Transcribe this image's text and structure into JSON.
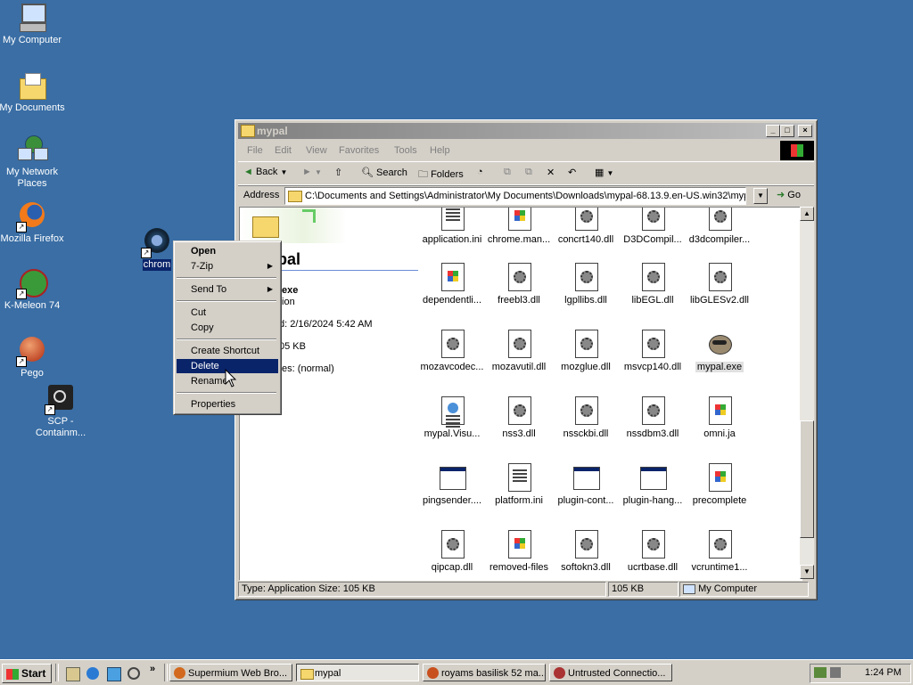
{
  "desktop": {
    "icons": [
      {
        "label": "My Computer"
      },
      {
        "label": "My Documents"
      },
      {
        "label": "My Network Places"
      },
      {
        "label": "Mozilla Firefox"
      },
      {
        "label": "K-Meleon 74"
      },
      {
        "label": "Pego"
      },
      {
        "label": "SCP - Containm..."
      },
      {
        "label": "chrom"
      }
    ]
  },
  "window": {
    "title": "mypal",
    "menu": [
      "File",
      "Edit",
      "View",
      "Favorites",
      "Tools",
      "Help"
    ],
    "toolbar": {
      "back": "Back",
      "search": "Search",
      "folders": "Folders"
    },
    "address_label": "Address",
    "address": "C:\\Documents and Settings\\Administrator\\My Documents\\Downloads\\mypal-68.13.9.en-US.win32\\mypal",
    "go": "Go",
    "webview": {
      "folder_title": "pal",
      "file_name": ".exe",
      "file_type": "tion",
      "modified": "d: 2/16/2024 5:42 AM",
      "size": "05 KB",
      "attributes": "tes: (normal)"
    },
    "files": [
      {
        "name": "application.ini",
        "icon": "ini-icon"
      },
      {
        "name": "chrome.man...",
        "icon": "windows-file-icon"
      },
      {
        "name": "concrt140.dll",
        "icon": "dll-icon"
      },
      {
        "name": "D3DCompil...",
        "icon": "dll-icon"
      },
      {
        "name": "d3dcompiler...",
        "icon": "dll-icon"
      },
      {
        "name": "dependentli...",
        "icon": "windows-file-icon"
      },
      {
        "name": "freebl3.dll",
        "icon": "dll-icon"
      },
      {
        "name": "lgpllibs.dll",
        "icon": "dll-icon"
      },
      {
        "name": "libEGL.dll",
        "icon": "dll-icon"
      },
      {
        "name": "libGLESv2.dll",
        "icon": "dll-icon"
      },
      {
        "name": "mozavcodec...",
        "icon": "dll-icon"
      },
      {
        "name": "mozavutil.dll",
        "icon": "dll-icon"
      },
      {
        "name": "mozglue.dll",
        "icon": "dll-icon"
      },
      {
        "name": "msvcp140.dll",
        "icon": "dll-icon"
      },
      {
        "name": "mypal.exe",
        "icon": "mypal-raccoon-icon"
      },
      {
        "name": "mypal.Visu...",
        "icon": "manifest-icon"
      },
      {
        "name": "nss3.dll",
        "icon": "dll-icon"
      },
      {
        "name": "nssckbi.dll",
        "icon": "dll-icon"
      },
      {
        "name": "nssdbm3.dll",
        "icon": "dll-icon"
      },
      {
        "name": "omni.ja",
        "icon": "windows-file-icon"
      },
      {
        "name": "pingsender....",
        "icon": "app-icon"
      },
      {
        "name": "platform.ini",
        "icon": "ini-icon"
      },
      {
        "name": "plugin-cont...",
        "icon": "app-icon"
      },
      {
        "name": "plugin-hang...",
        "icon": "app-icon"
      },
      {
        "name": "precomplete",
        "icon": "windows-file-icon"
      },
      {
        "name": "qipcap.dll",
        "icon": "dll-icon"
      },
      {
        "name": "removed-files",
        "icon": "windows-file-icon"
      },
      {
        "name": "softokn3.dll",
        "icon": "dll-icon"
      },
      {
        "name": "ucrtbase.dll",
        "icon": "dll-icon"
      },
      {
        "name": "vcruntime1...",
        "icon": "dll-icon"
      }
    ],
    "status": {
      "info": "Type: Application Size: 105 KB",
      "size": "105 KB",
      "zone": "My Computer"
    }
  },
  "context_menu": {
    "items": [
      "Open",
      "7-Zip",
      "Send To",
      "Cut",
      "Copy",
      "Create Shortcut",
      "Delete",
      "Rename",
      "Properties"
    ],
    "selected": "Delete"
  },
  "taskbar": {
    "start": "Start",
    "tasks": [
      {
        "label": "Supermium Web Bro..."
      },
      {
        "label": "mypal"
      },
      {
        "label": "royams basilisk 52 ma..."
      },
      {
        "label": "Untrusted Connectio..."
      }
    ],
    "clock": "1:24 PM"
  }
}
